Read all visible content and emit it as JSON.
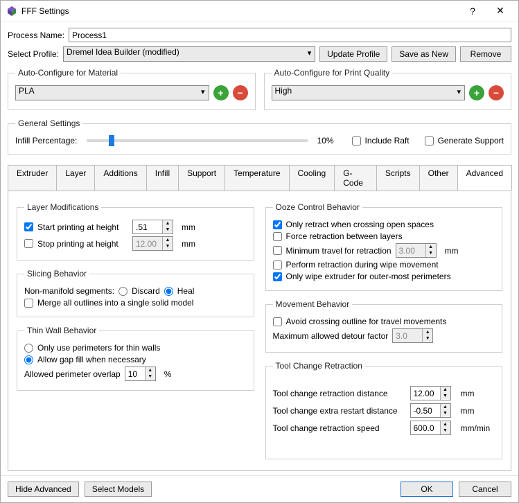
{
  "window": {
    "title": "FFF Settings"
  },
  "processName": {
    "label": "Process Name:",
    "value": "Process1"
  },
  "profile": {
    "label": "Select Profile:",
    "selected": "Dremel Idea Builder (modified)",
    "update": "Update Profile",
    "saveAs": "Save as New",
    "remove": "Remove"
  },
  "autoMaterial": {
    "legend": "Auto-Configure for Material",
    "selected": "PLA"
  },
  "autoQuality": {
    "legend": "Auto-Configure for Print Quality",
    "selected": "High"
  },
  "general": {
    "legend": "General Settings",
    "infillLabel": "Infill Percentage:",
    "infillValue": "10%",
    "includeRaft": "Include Raft",
    "generateSupport": "Generate Support"
  },
  "tabs": [
    "Extruder",
    "Layer",
    "Additions",
    "Infill",
    "Support",
    "Temperature",
    "Cooling",
    "G-Code",
    "Scripts",
    "Other",
    "Advanced"
  ],
  "activeTab": "Advanced",
  "layerMods": {
    "legend": "Layer Modifications",
    "startLabel": "Start printing at height",
    "startValue": ".51",
    "stopLabel": "Stop printing at height",
    "stopValue": "12.00",
    "unit": "mm"
  },
  "slicing": {
    "legend": "Slicing Behavior",
    "nonManifold": "Non-manifold segments:",
    "discard": "Discard",
    "heal": "Heal",
    "merge": "Merge all outlines into a single solid model"
  },
  "thinWall": {
    "legend": "Thin Wall Behavior",
    "perimOnly": "Only use perimeters for thin walls",
    "gapFill": "Allow gap fill when necessary",
    "overlapLabel": "Allowed perimeter overlap",
    "overlapValue": "10",
    "overlapUnit": "%"
  },
  "ooze": {
    "legend": "Ooze Control Behavior",
    "onlyRetract": "Only retract when crossing open spaces",
    "forceRetract": "Force retraction between layers",
    "minTravelLabel": "Minimum travel for retraction",
    "minTravelValue": "3.00",
    "minTravelUnit": "mm",
    "performWipe": "Perform retraction during wipe movement",
    "onlyWipe": "Only wipe extruder for outer-most perimeters"
  },
  "movement": {
    "legend": "Movement Behavior",
    "avoid": "Avoid crossing outline for travel movements",
    "detourLabel": "Maximum allowed detour factor",
    "detourValue": "3.0"
  },
  "toolChange": {
    "legend": "Tool Change Retraction",
    "distLabel": "Tool change retraction distance",
    "distValue": "12.00",
    "extraLabel": "Tool change extra restart distance",
    "extraValue": "-0.50",
    "speedLabel": "Tool change retraction speed",
    "speedValue": "600.0",
    "mm": "mm",
    "mmMin": "mm/min"
  },
  "footer": {
    "hide": "Hide Advanced",
    "select": "Select Models",
    "ok": "OK",
    "cancel": "Cancel"
  }
}
